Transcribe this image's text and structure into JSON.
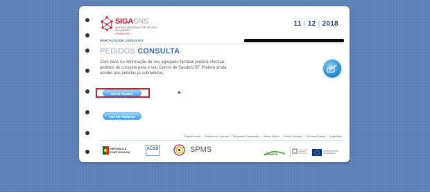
{
  "header": {
    "brand_primary": "SIGA",
    "brand_secondary": "SNS",
    "brand_subtitle": "SISTEMA INTEGRADO DE GESTÃO DO ACESSO",
    "brand_tagline": "CONSULTAS",
    "date": {
      "day": "11",
      "month": "12",
      "year": "2018"
    }
  },
  "breadcrumb": "MARCAÇÃO DE CONSULTAS",
  "page": {
    "title_light": "PEDIDOS",
    "title_bold": "CONSULTA",
    "description": "Com base na informação do seu agregado familiar, poderá efectuar pedidos de consulta para o seu Centro de Saúde/USF. Poderá ainda aceder aos pedidos já submetidos."
  },
  "actions": {
    "new_request": "NOVO PEDIDO",
    "list_requests": "LISTAR PEDIDOS"
  },
  "footer": {
    "links": [
      "Página Inicial",
      "Pedidos de Consulta",
      "Perguntas Frequentes",
      "Alterar Senha",
      "Outros Serviços",
      "Os Meus Dados",
      "Sugestões"
    ],
    "partners": {
      "republica": [
        "REPÚBLICA",
        "PORTUGUESA"
      ],
      "acss": "ACSS",
      "spms": "SPMS",
      "compete": "COMPETE"
    }
  },
  "colors": {
    "accent_blue": "#3e6fb0",
    "brand_red": "#c8102e",
    "highlight": "#d01a2a"
  }
}
